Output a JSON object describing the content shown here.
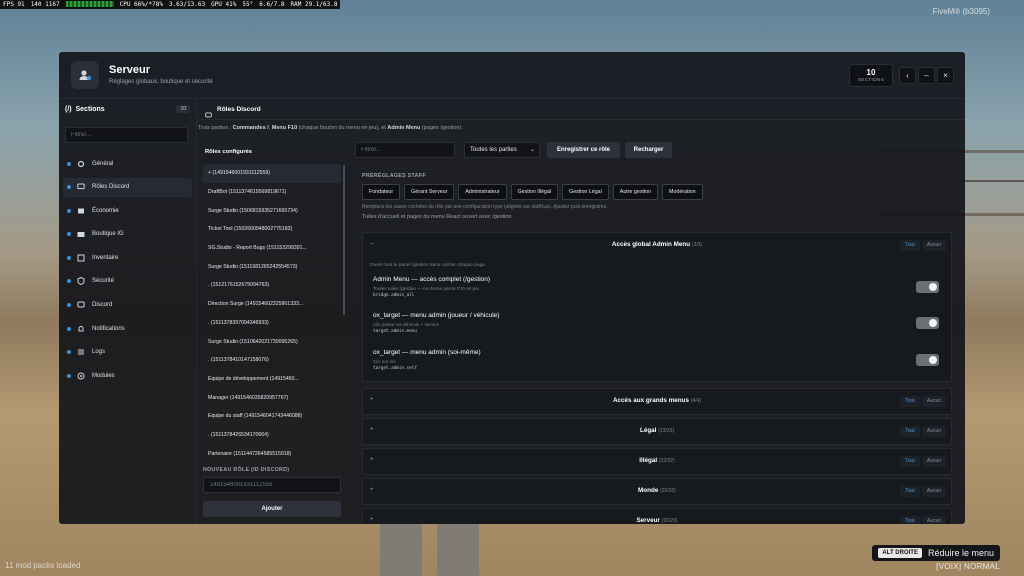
{
  "overlay": {
    "perf": [
      "FPS 91",
      "140 1167",
      "CPU 66%/*78%",
      "3.63/13.63",
      "GPU 41%",
      "55°",
      "6.6/7.8",
      "RAM 29.1/63.8"
    ],
    "fivem": "FiveM® (b3095)",
    "modpacks": "11 mod packs loaded",
    "hint_key": "ALT DROITE",
    "hint_text": "Réduire le menu",
    "voice": "[VOIX] NORMAL"
  },
  "header": {
    "title": "Serveur",
    "subtitle": "Réglages globaux, boutique et sécurité",
    "sections_count": "10",
    "sections_label": "SECTIONS",
    "btn_prev": "‹",
    "btn_min": "–",
    "btn_close": "×"
  },
  "sidebar": {
    "title": "Sections",
    "badge": "10",
    "filter_placeholder": "Filtrer...",
    "items": [
      {
        "label": "Général",
        "icon": "gear-icon"
      },
      {
        "label": "Rôles Discord",
        "icon": "chat-icon"
      },
      {
        "label": "Économie",
        "icon": "wallet-icon"
      },
      {
        "label": "Boutique IG",
        "icon": "store-icon"
      },
      {
        "label": "Inventaire",
        "icon": "box-icon"
      },
      {
        "label": "Sécurité",
        "icon": "shield-icon"
      },
      {
        "label": "Discord",
        "icon": "discord-icon"
      },
      {
        "label": "Notifications",
        "icon": "bell-icon"
      },
      {
        "label": "Logs",
        "icon": "list-icon"
      },
      {
        "label": "Modules",
        "icon": "puzzle-icon"
      }
    ]
  },
  "breadcrumb": "Rôles Discord",
  "note": {
    "pre": "Trois parties : ",
    "b1": "Commandes /",
    "mid1": ", ",
    "b2": "Menu F10",
    "mid2": " (chaque bouton du menu en jeu), et ",
    "b3": "Admin Menu",
    "post": " (pages /gestion)."
  },
  "roles": {
    "title": "Rôles configurés",
    "items": [
      "+ (1491546001931112559)",
      "DraftBot (1511374619569819671)",
      "Surge Studio (1506815935271665734)",
      "Ticket Tool (1502660948002775183)",
      "SG.Studio - Report Bugs (151153299391...",
      "Surge Studio (1511681265242554573)",
      ". (1512176152675094763)",
      "Direction Surge (149154602325901333...",
      ". (1511378397094346933)",
      "Surge Studio (1510642021730095265)",
      ". (1511378410147158076)",
      "Equipe de développement (14915460...",
      "Manager (1491546035820957767)",
      "Equipe du staff (1491546041743446088)",
      ". (1511378426534170664)",
      "Partenaire (1511447264585515018)"
    ],
    "new_label": "NOUVEAU RÔLE (ID DISCORD)",
    "new_placeholder": "1491546001931112559",
    "add_label": "Ajouter"
  },
  "editor": {
    "search_placeholder": "Filtrer...",
    "select_value": "Toutes les parties",
    "save_label": "Enregistrer ce rôle",
    "reload_label": "Recharger",
    "presets_label": "PRÉRÉGLAGES STAFF",
    "presets": [
      "Fondateur",
      "Gérant Serveur",
      "Administrateur",
      "Gestion Illégal",
      "Gestion Légal",
      "Autre gestion",
      "Modération"
    ],
    "help1": "Remplace les cases cochées du rôle par une configuration type (alignée sur staff.lua). Ajustez puis enregistrez.",
    "help2": "Tuiles d'accueil et pages du menu React ouvert avec /gestion.",
    "tout": "Tout",
    "aucun": "Aucun",
    "sections": [
      {
        "name": "Accès global Admin Menu",
        "count": "(3/3)",
        "description": "Ouvre tout le panel /gestion sans cocher chaque page.",
        "perms": [
          {
            "title": "Admin Menu — accès complet (/gestion)",
            "desc": "Toutes tuiles /gestion — ne donne pas le F10 en jeu",
            "code": "bridge.admin_all",
            "enabled": true
          },
          {
            "title": "ox_target — menu admin (joueur / véhicule)",
            "desc": "Clic joueur ou véhicule + service",
            "code": "target.admin.menu",
            "enabled": true
          },
          {
            "title": "ox_target — menu admin (soi-même)",
            "desc": "Clic sur soi",
            "code": "target.admin.self",
            "enabled": true
          }
        ]
      },
      {
        "name": "Accès aux grands menus",
        "count": "(4/4)"
      },
      {
        "name": "Légal",
        "count": "(23/25)"
      },
      {
        "name": "Illégal",
        "count": "(32/32)"
      },
      {
        "name": "Monde",
        "count": "(33/33)"
      },
      {
        "name": "Serveur",
        "count": "(20/20)"
      }
    ]
  }
}
